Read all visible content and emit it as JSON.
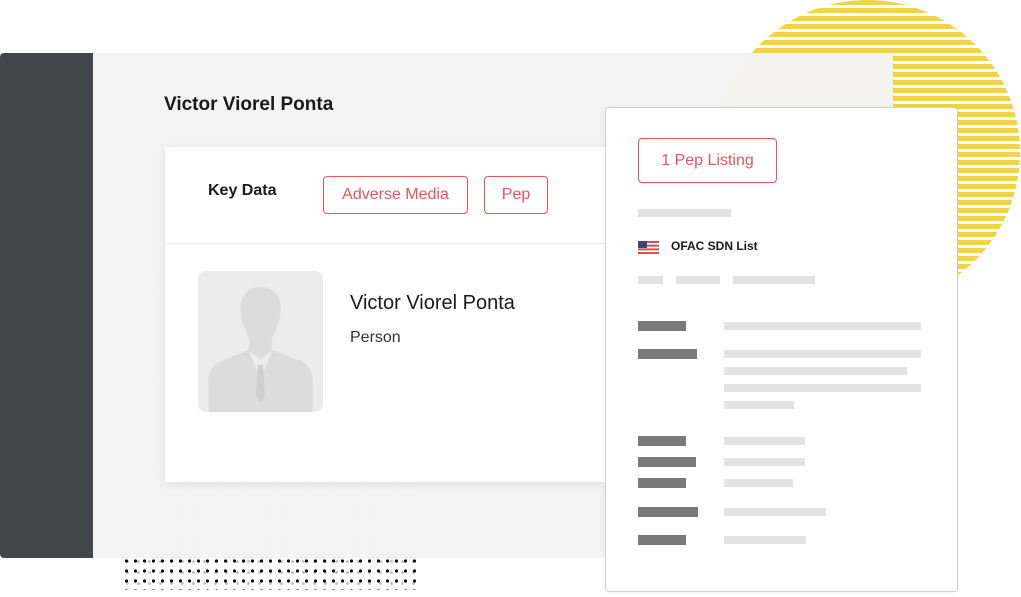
{
  "profile": {
    "title": "Victor Viorel Ponta"
  },
  "card": {
    "tab_key_data": "Key Data",
    "tag_adverse_media": "Adverse Media",
    "tag_pep": "Pep",
    "entity_name": "Victor Viorel Ponta",
    "entity_type": "Person"
  },
  "panel": {
    "pep_listing_button": "1 Pep Listing",
    "list_flag_icon": "us-flag-icon",
    "list_name": "OFAC SDN List"
  },
  "colors": {
    "accent_red": "#e5575c",
    "sidebar": "#42464b",
    "sun_yellow": "#f0d34a"
  }
}
